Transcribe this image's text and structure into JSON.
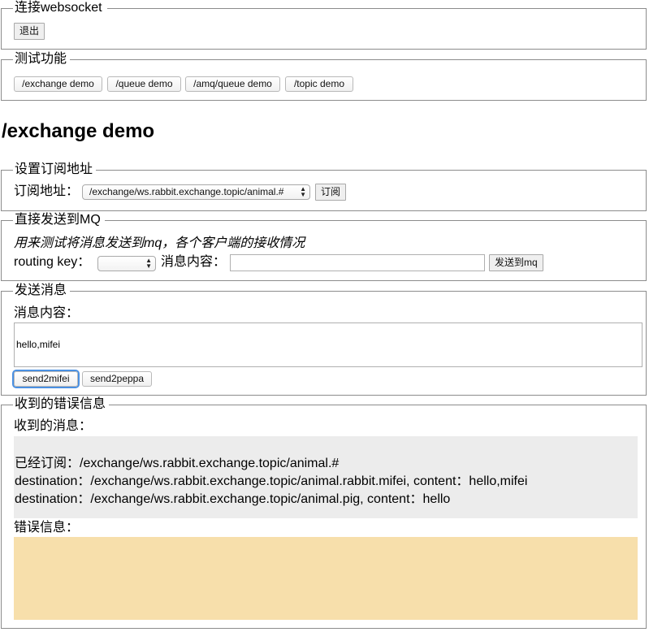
{
  "connect": {
    "legend": "连接websocket",
    "logout_label": "退出"
  },
  "test": {
    "legend": "测试功能",
    "buttons": [
      "/exchange demo",
      "/queue demo",
      "/amq/queue demo",
      "/topic demo"
    ]
  },
  "page_title": "/exchange demo",
  "subscribe": {
    "legend": "设置订阅地址",
    "label": "订阅地址：",
    "selected": "/exchange/ws.rabbit.exchange.topic/animal.#",
    "button": "订阅"
  },
  "mq": {
    "legend": "直接发送到MQ",
    "hint": "用来测试将消息发送到mq，各个客户端的接收情况",
    "routing_label": "routing key：",
    "routing_selected": "",
    "content_label": "消息内容：",
    "content_value": "",
    "send_button": "发送到mq"
  },
  "send": {
    "legend": "发送消息",
    "content_label": "消息内容：",
    "content_value": "hello,mifei",
    "btn_mifei": "send2mifei",
    "btn_peppa": "send2peppa"
  },
  "received": {
    "legend": "收到的错误信息",
    "messages_label": "收到的消息：",
    "messages": [
      "已经订阅：/exchange/ws.rabbit.exchange.topic/animal.#",
      "destination：/exchange/ws.rabbit.exchange.topic/animal.rabbit.mifei, content：hello,mifei",
      "destination：/exchange/ws.rabbit.exchange.topic/animal.pig, content：hello"
    ],
    "errors_label": "错误信息："
  },
  "colors": {
    "messages_bg": "#ececec",
    "errors_bg": "#f7dfab",
    "focus_ring": "#4a90e2"
  }
}
